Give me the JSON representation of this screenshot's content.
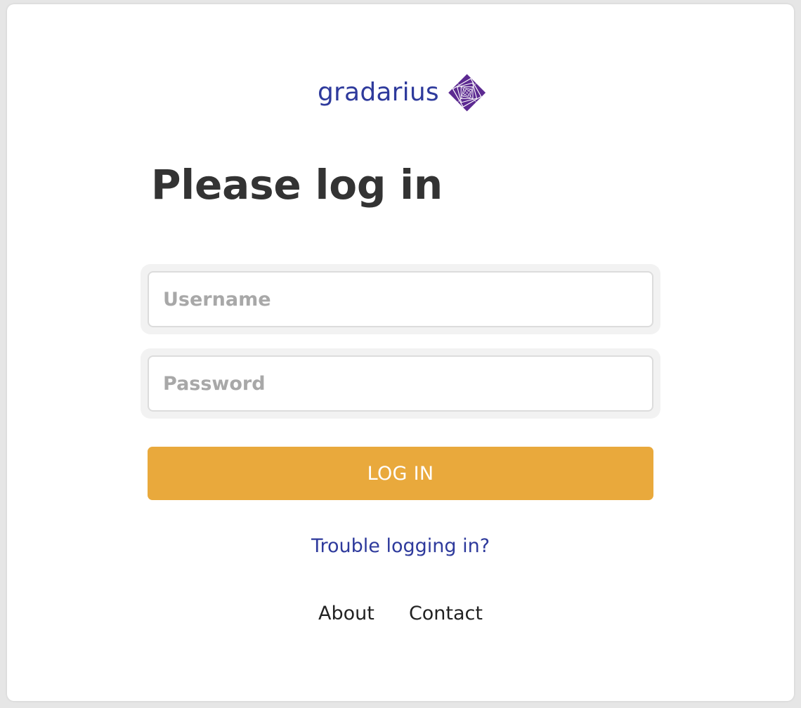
{
  "brand": {
    "name": "gradarius",
    "logo_icon": "gradarius-diamond-logo-icon",
    "color": "#2e3a9c",
    "logo_color": "#5c2a91"
  },
  "heading": "Please log in",
  "form": {
    "username_placeholder": "Username",
    "username_value": "",
    "password_placeholder": "Password",
    "password_value": "",
    "submit_label": "LOG IN",
    "submit_color": "#e9a93c"
  },
  "links": {
    "trouble": "Trouble logging in?",
    "about": "About",
    "contact": "Contact"
  }
}
